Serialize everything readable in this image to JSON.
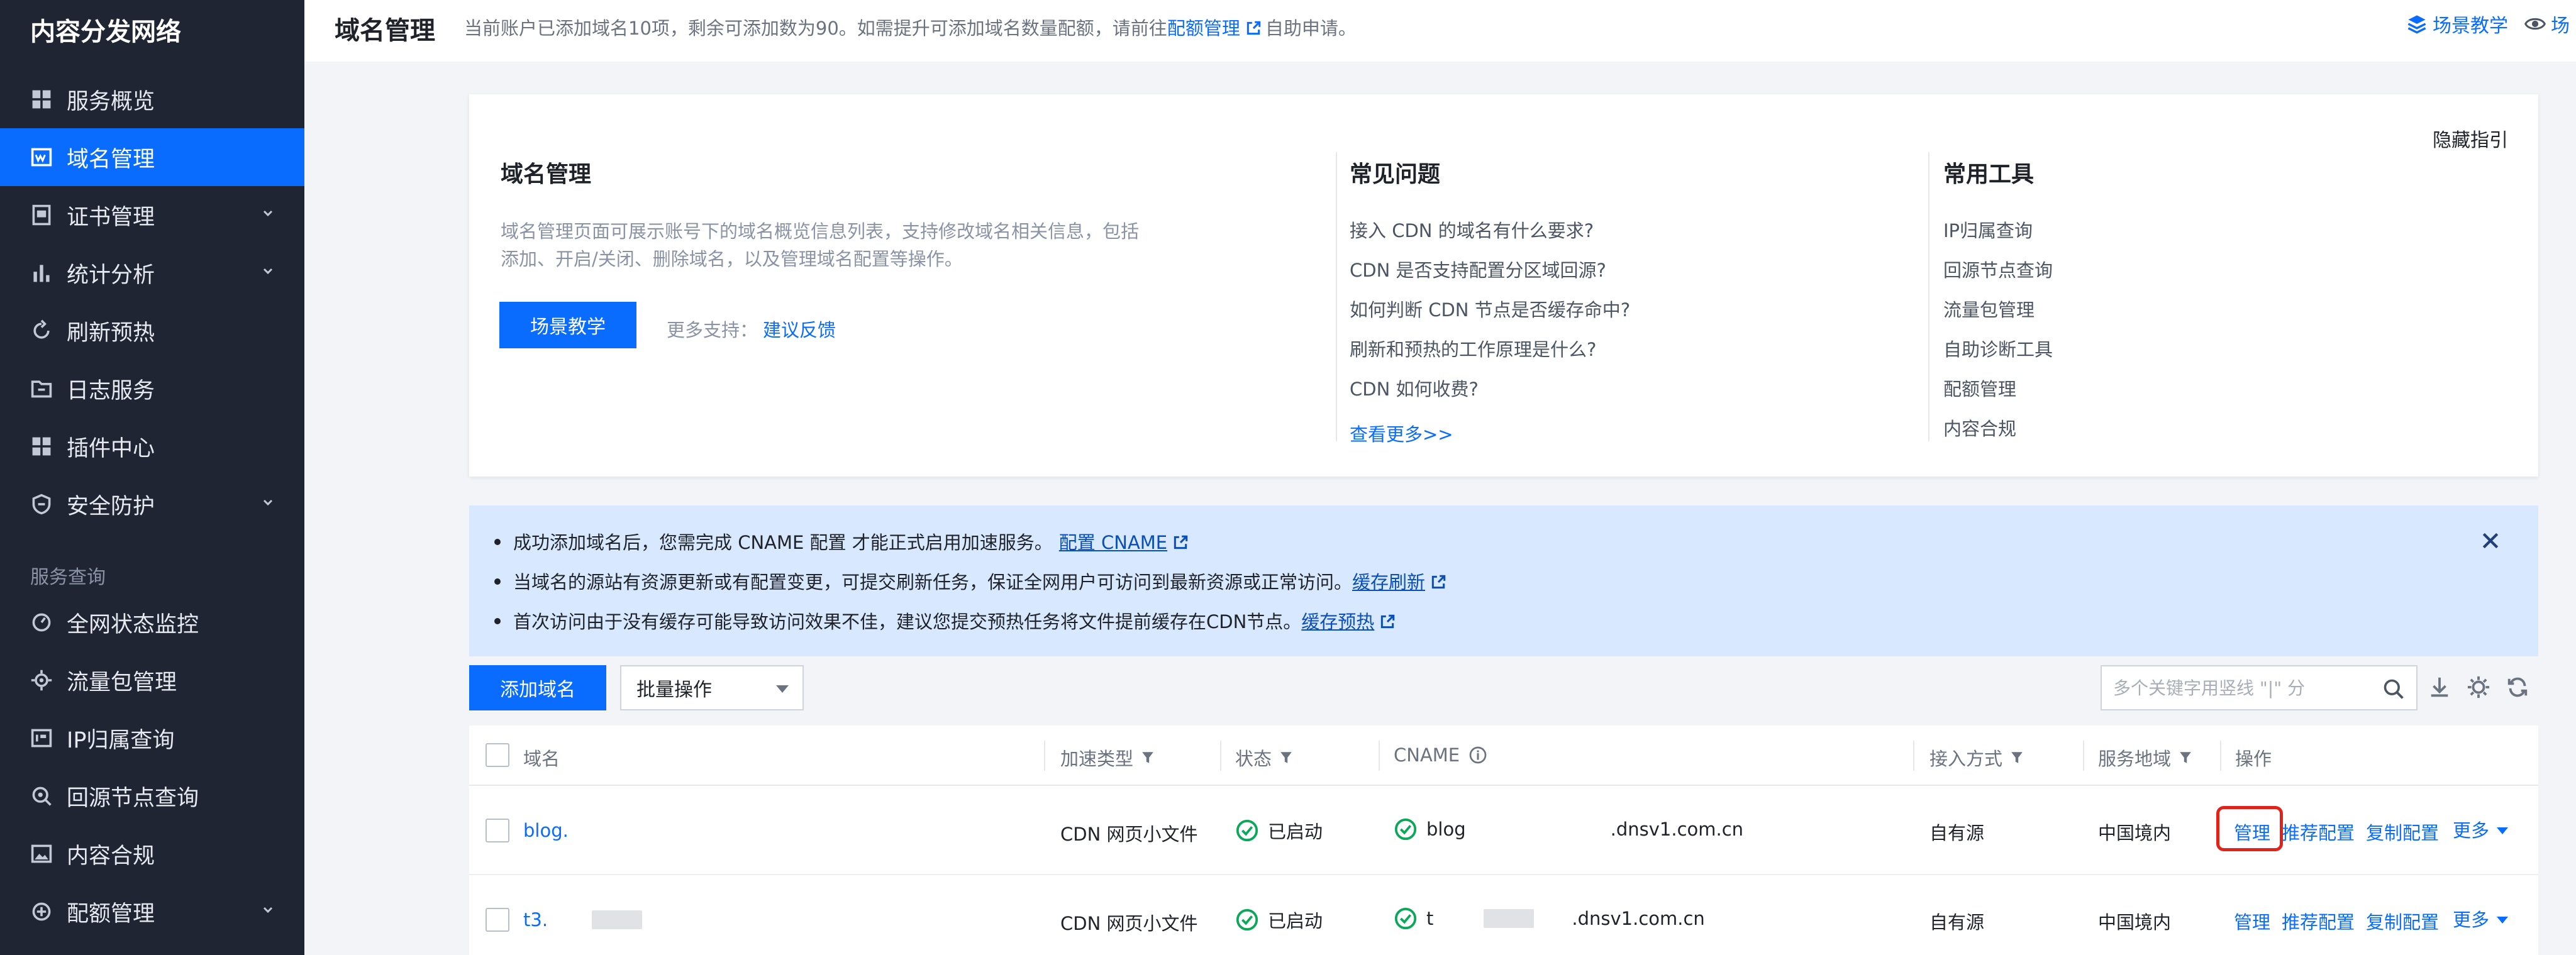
{
  "sidebar": {
    "title": "内容分发网络",
    "items": [
      {
        "label": "服务概览"
      },
      {
        "label": "域名管理"
      },
      {
        "label": "证书管理"
      },
      {
        "label": "统计分析"
      },
      {
        "label": "刷新预热"
      },
      {
        "label": "日志服务"
      },
      {
        "label": "插件中心"
      },
      {
        "label": "安全防护"
      }
    ],
    "section_label": "服务查询",
    "query_items": [
      {
        "label": "全网状态监控"
      },
      {
        "label": "流量包管理"
      },
      {
        "label": "IP归属查询"
      },
      {
        "label": "回源节点查询"
      },
      {
        "label": "内容合规"
      },
      {
        "label": "配额管理"
      }
    ]
  },
  "header": {
    "title": "域名管理",
    "desc_prefix": "当前账户已添加域名10项，剩余可添加数为90。如需提升可添加域名数量配额，请前往",
    "desc_link": "配额管理",
    "desc_suffix": "自助申请。",
    "scene_link": "场景教学",
    "right_cut": "场"
  },
  "guide": {
    "hide_label": "隐藏指引",
    "title": "域名管理",
    "description": "域名管理页面可展示账号下的域名概览信息列表，支持修改域名相关信息，包括添加、开启/关闭、删除域名，以及管理域名配置等操作。",
    "scene_button": "场景教学",
    "more_support_label": "更多支持：",
    "feedback_link": "建议反馈",
    "faq_title": "常见问题",
    "faq": [
      "接入 CDN 的域名有什么要求?",
      "CDN 是否支持配置分区域回源?",
      "如何判断 CDN 节点是否缓存命中?",
      "刷新和预热的工作原理是什么?",
      "CDN 如何收费?"
    ],
    "faq_more": "查看更多>>",
    "tools_title": "常用工具",
    "tools": [
      "IP归属查询",
      "回源节点查询",
      "流量包管理",
      "自助诊断工具",
      "配额管理",
      "内容合规"
    ]
  },
  "notice": {
    "lines": [
      {
        "text": "成功添加域名后，您需完成 CNAME 配置 才能正式启用加速服务。",
        "link": "配置 CNAME"
      },
      {
        "text": "当域名的源站有资源更新或有配置变更，可提交刷新任务，保证全网用户可访问到最新资源或正常访问。",
        "link": "缓存刷新"
      },
      {
        "text": "首次访问由于没有缓存可能导致访问效果不佳，建议您提交预热任务将文件提前缓存在CDN节点。",
        "link": "缓存预热"
      }
    ]
  },
  "toolbar": {
    "add_button": "添加域名",
    "batch_select": "批量操作",
    "search_placeholder": "多个关键字用竖线 \"|\" 分"
  },
  "table": {
    "columns": {
      "domain": "域名",
      "type": "加速类型",
      "status": "状态",
      "cname": "CNAME",
      "access": "接入方式",
      "region": "服务地域",
      "actions": "操作"
    },
    "rows": [
      {
        "domain": "blog.",
        "type": "CDN 网页小文件",
        "status": "已启动",
        "cname_prefix": "blog",
        "cname_suffix": ".dnsv1.com.cn",
        "access": "自有源",
        "region": "中国境内"
      },
      {
        "domain": "t3.",
        "type": "CDN 网页小文件",
        "status": "已启动",
        "cname_prefix": "t",
        "cname_suffix": ".dnsv1.com.cn",
        "access": "自有源",
        "region": "中国境内"
      }
    ],
    "ops": {
      "manage": "管理",
      "recommend": "推荐配置",
      "copy": "复制配置",
      "more": "更多"
    }
  }
}
